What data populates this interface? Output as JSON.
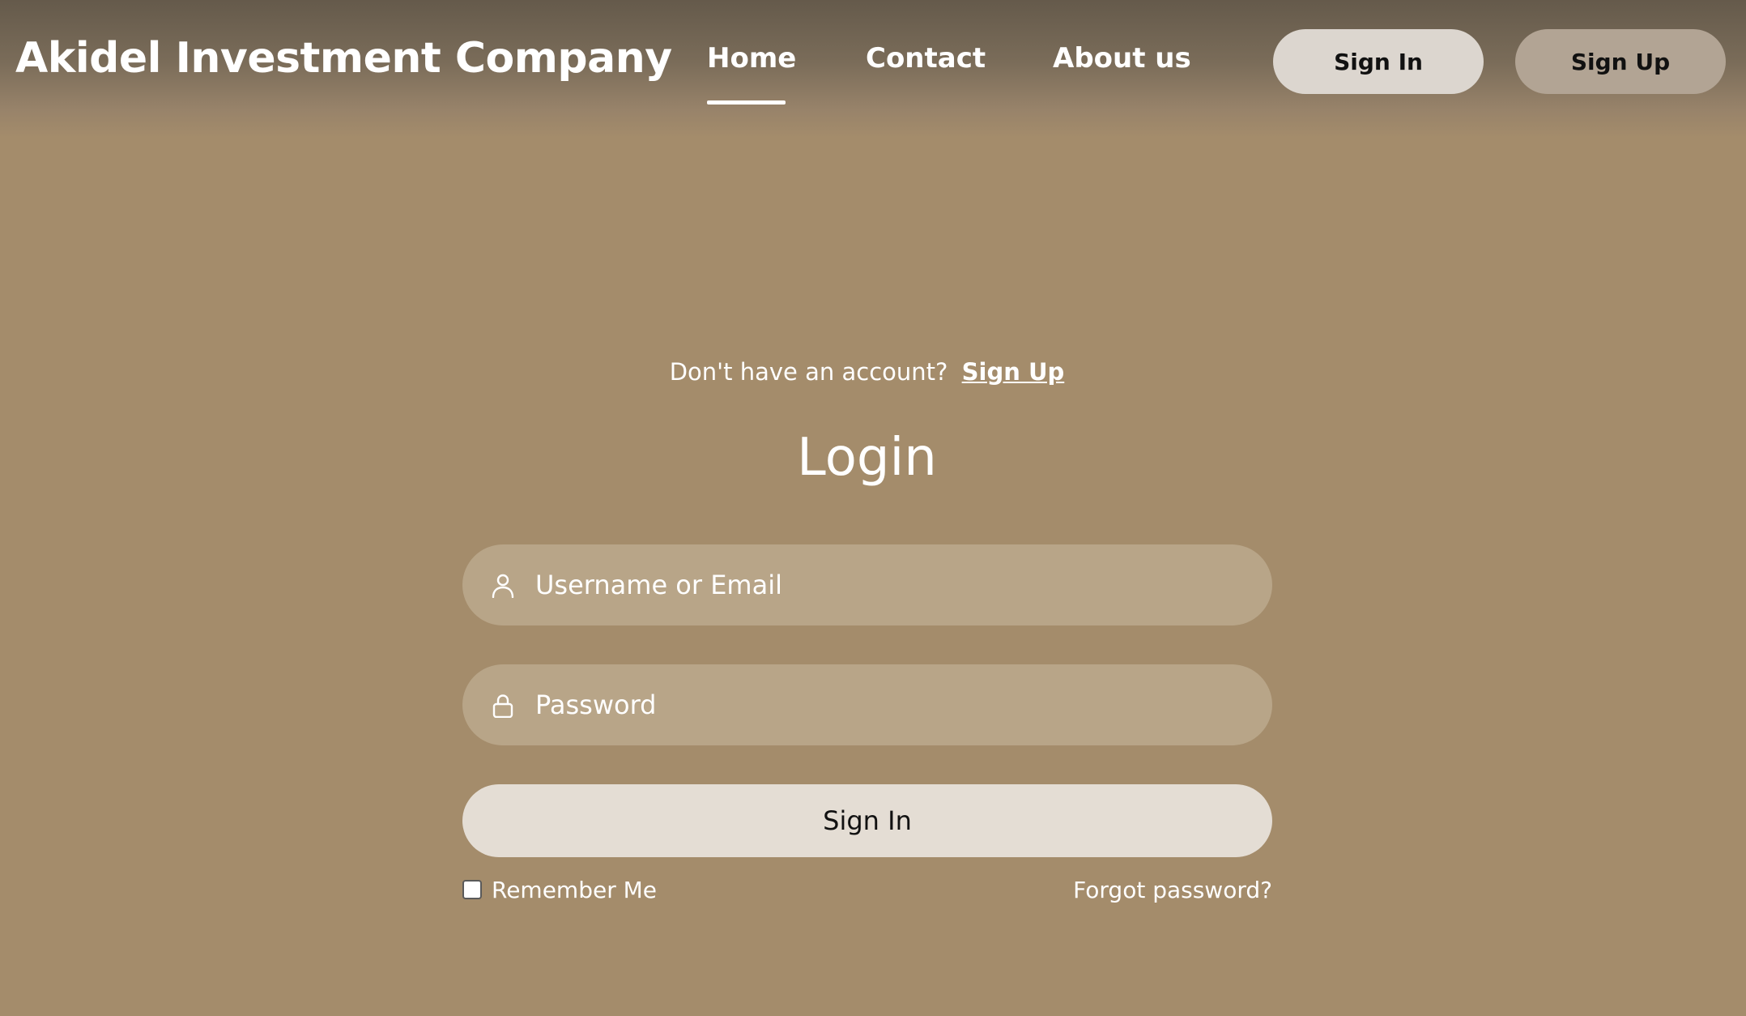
{
  "header": {
    "brand": "Akidel Investment Company",
    "nav": [
      {
        "label": "Home",
        "active": true
      },
      {
        "label": "Contact",
        "active": false
      },
      {
        "label": "About us",
        "active": false
      }
    ],
    "signin_label": "Sign In",
    "signup_label": "Sign Up"
  },
  "login": {
    "account_prompt": "Don't have an account?",
    "signup_link": "Sign Up",
    "title": "Login",
    "username": {
      "placeholder": "Username or Email",
      "value": "",
      "icon": "user-icon"
    },
    "password": {
      "placeholder": "Password",
      "value": "",
      "icon": "lock-icon"
    },
    "submit_label": "Sign In",
    "remember_label": "Remember Me",
    "remember_checked": false,
    "forgot_label": "Forgot password?"
  },
  "colors": {
    "background": "#a48c6b",
    "header_top": "#655a4b",
    "input_bg": "#b8a588",
    "primary_button": "#e4ddd4",
    "signin_top_button": "#dcd6cf",
    "signup_top_button": "#b2a494"
  }
}
